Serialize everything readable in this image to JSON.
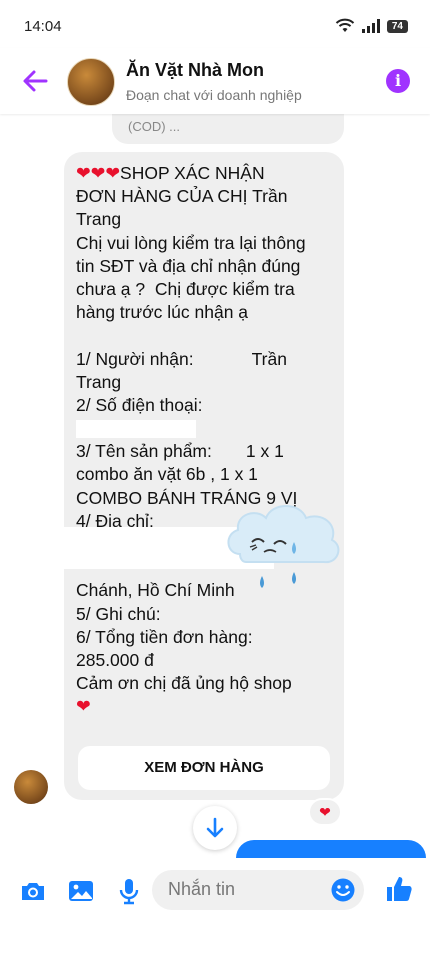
{
  "status_bar": {
    "time": "14:04",
    "battery": "74"
  },
  "header": {
    "title": "Ăn Vặt Nhà Mon",
    "subtitle": "Đoạn chat với doanh nghiệp"
  },
  "previous_message": {
    "text": "(COD) ..."
  },
  "message": {
    "lines": [
      "SHOP XÁC NHẬN",
      "ĐƠN HÀNG CỦA CHỊ Trần",
      "Trang",
      "Chị vui lòng kiểm tra lại thông",
      "tin SĐT và địa chỉ nhận đúng",
      "chưa ạ ?  Chị được kiểm tra",
      "hàng trước lúc nhận ạ",
      "",
      "1/ Người nhận:            Trần",
      "Trang",
      "2/ Số điện thoại:",
      "",
      "3/ Tên sản phẩm:       1 x 1",
      "combo ăn vặt 6b , 1 x 1",
      "COMBO BÁNH TRÁNG 9 VỊ",
      "4/ Địa chỉ:",
      "",
      "",
      "Chánh, Hồ Chí Minh",
      "5/ Ghi chú:",
      "6/ Tổng tiền đơn hàng:",
      "285.000 đ",
      "Cảm ơn chị đã ủng hộ shop"
    ],
    "heart": "❤",
    "button_label": "XEM ĐƠN HÀNG"
  },
  "reaction": "❤",
  "composer": {
    "placeholder": "Nhắn tin"
  },
  "colors": {
    "accent": "#a033ff",
    "messenger_blue": "#1780ff",
    "bubble": "#efefef",
    "heart": "#e8112d"
  }
}
